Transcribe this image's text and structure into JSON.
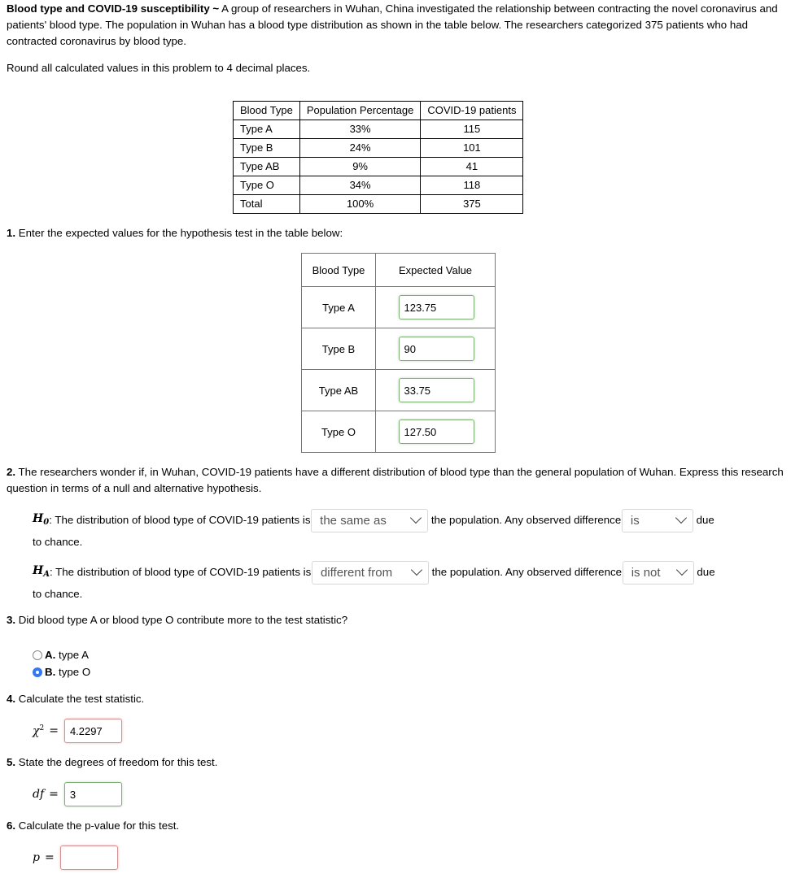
{
  "intro": {
    "title": "Blood type and COVID-19 susceptibility ~",
    "text": " A group of researchers in Wuhan, China investigated the relationship between contracting the novel coronavirus and patients' blood type. The population in Wuhan has a blood type distribution as shown in the table below. The researchers categorized 375 patients who had contracted coronavirus by blood type.",
    "rounding": "Round all calculated values in this problem to 4 decimal places."
  },
  "population_table": {
    "headers": [
      "Blood Type",
      "Population Percentage",
      "COVID-19 patients"
    ],
    "rows": [
      [
        "Type A",
        "33%",
        "115"
      ],
      [
        "Type B",
        "24%",
        "101"
      ],
      [
        "Type AB",
        "9%",
        "41"
      ],
      [
        "Type O",
        "34%",
        "118"
      ],
      [
        "Total",
        "100%",
        "375"
      ]
    ]
  },
  "q1": {
    "number": "1.",
    "text": " Enter the expected values for the hypothesis test in the table below:",
    "headers": [
      "Blood Type",
      "Expected Value"
    ],
    "rows": [
      {
        "type": "Type A",
        "value": "123.75"
      },
      {
        "type": "Type B",
        "value": "90"
      },
      {
        "type": "Type AB",
        "value": "33.75"
      },
      {
        "type": "Type O",
        "value": "127.50"
      }
    ]
  },
  "q2": {
    "number": "2.",
    "text": " The researchers wonder if, in Wuhan, COVID-19 patients have a different distribution of blood type than the general population of Wuhan. Express this research question in terms of a null and alternative hypothesis.",
    "h0": {
      "symbol": "H",
      "sub": "0",
      "text_before": ": The distribution of blood type of COVID-19 patients is ",
      "select1": "the same as",
      "text_middle": " the population. Any observed difference ",
      "select2": "is",
      "text_after": " due",
      "text_wrap": "to chance."
    },
    "ha": {
      "symbol": "H",
      "sub": "A",
      "text_before": ": The distribution of blood type of COVID-19 patients is ",
      "select1": "different from",
      "text_middle": " the population. Any observed difference ",
      "select2": "is not",
      "text_after": " due",
      "text_wrap": "to chance."
    }
  },
  "q3": {
    "number": "3.",
    "text": " Did blood type A or blood type O contribute more to the test statistic?",
    "options": [
      {
        "letter": "A.",
        "label": " type A",
        "selected": false
      },
      {
        "letter": "B.",
        "label": " type O",
        "selected": true
      }
    ]
  },
  "q4": {
    "number": "4.",
    "text": " Calculate the test statistic.",
    "symbol": "χ",
    "sup": "2",
    "equals": "=",
    "value": "4.2297"
  },
  "q5": {
    "number": "5.",
    "text": " State the degrees of freedom for this test.",
    "symbol": "df",
    "equals": "=",
    "value": "3"
  },
  "q6": {
    "number": "6.",
    "text": " Calculate the p-value for this test.",
    "symbol": "p",
    "equals": "=",
    "value": ""
  },
  "colors": {
    "correct_border": "#7fae74",
    "incorrect_border": "#d68f8f",
    "radio_selected": "#3478f6"
  }
}
